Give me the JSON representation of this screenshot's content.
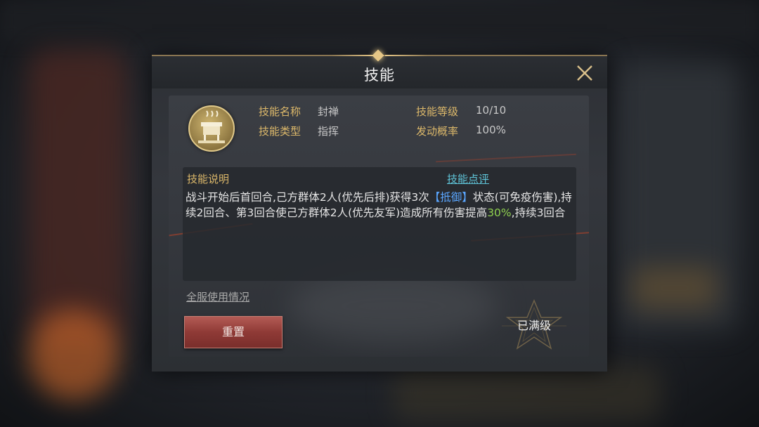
{
  "dialog": {
    "title": "技能"
  },
  "skill": {
    "icon": "cauldron-icon",
    "name_label": "技能名称",
    "name_value": "封禅",
    "type_label": "技能类型",
    "type_value": "指挥",
    "level_label": "技能等级",
    "level_value": "10/10",
    "chance_label": "发动概率",
    "chance_value": "100%"
  },
  "description": {
    "title": "技能说明",
    "review_link": "技能点评",
    "text_part1": "战斗开始后首回合,己方群体2人(优先后排)获得3次",
    "keyword": "【抵御】",
    "text_part2": "状态(可免疫伤害),持续2回合、第3回合使己方群体2人(优先友军)造成所有伤害提高",
    "percent": "30%",
    "text_part3": ",持续3回合"
  },
  "footer": {
    "usage_link": "全服使用情况",
    "reset_button": "重置",
    "max_badge": "已满级"
  },
  "colors": {
    "label_gold": "#dcb86a",
    "link_cyan": "#5fc4d8",
    "keyword_blue": "#5aa6ff",
    "percent_green": "#8fd14f",
    "reset_red": "#8f3a36"
  }
}
